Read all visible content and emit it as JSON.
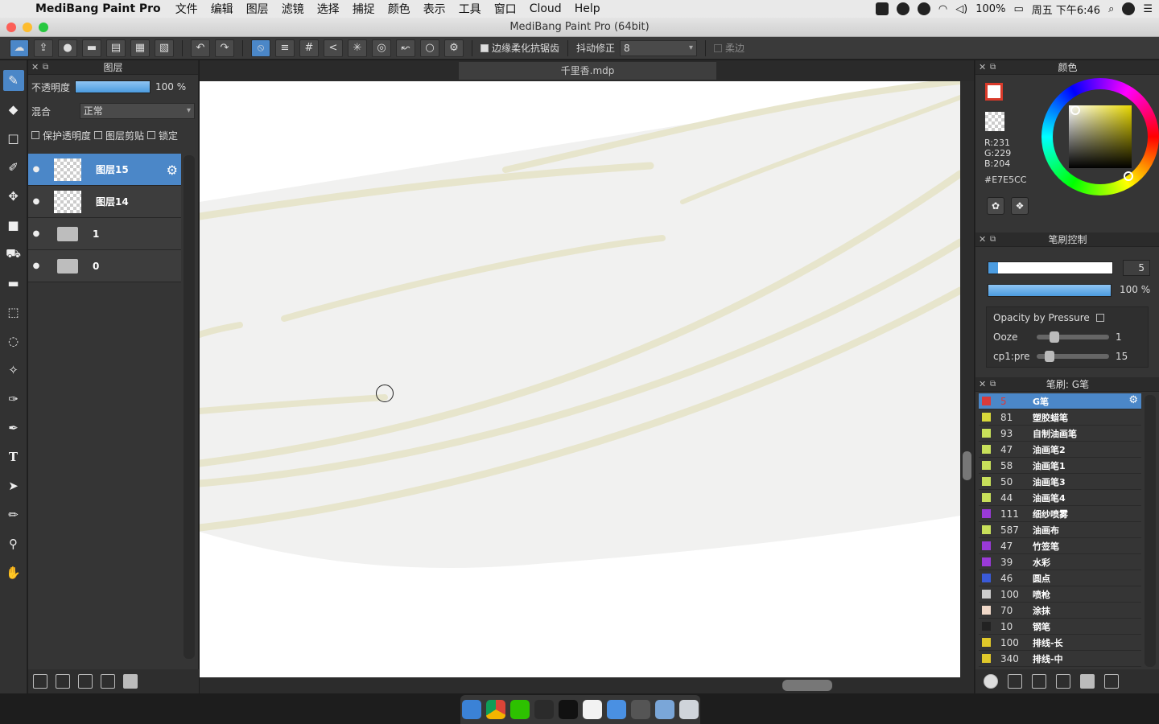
{
  "menubar": {
    "app_name": "MediBang Paint Pro",
    "items": [
      "文件",
      "编辑",
      "图层",
      "滤镜",
      "选择",
      "捕捉",
      "颜色",
      "表示",
      "工具",
      "窗口",
      "Cloud",
      "Help"
    ],
    "battery": "100%",
    "datetime": "周五 下午6:46"
  },
  "window": {
    "title": "MediBang Paint Pro (64bit)"
  },
  "toolbar": {
    "antialias_label": "边缘柔化抗锯齿",
    "stabilizer_label": "抖动修正",
    "stabilizer_value": "8",
    "soft_label": "柔边"
  },
  "layer_panel": {
    "title": "图层",
    "opacity_label": "不透明度",
    "opacity_value": "100 %",
    "opacity_fraction": 1.0,
    "blend_label": "混合",
    "blend_value": "正常",
    "protect_alpha_label": "保护透明度",
    "clip_label": "图层剪贴",
    "lock_label": "锁定",
    "layers": [
      {
        "name": "图层15",
        "type": "layer",
        "selected": true
      },
      {
        "name": "图层14",
        "type": "layer",
        "selected": false
      },
      {
        "name": "1",
        "type": "folder",
        "selected": false
      },
      {
        "name": "0",
        "type": "folder",
        "selected": false
      }
    ]
  },
  "document": {
    "tab_name": "千里香.mdp"
  },
  "color_panel": {
    "title": "颜色",
    "r": "R:231",
    "g": "G:229",
    "b": "B:204",
    "hex": "#E7E5CC",
    "hue_color": "#e8d800"
  },
  "brush_control": {
    "title": "笔刷控制",
    "size_value": "5",
    "opacity_value": "100 %",
    "opacity_by_pressure_label": "Opacity by Pressure",
    "ooze_label": "Ooze",
    "ooze_value": "1",
    "cp1_label": "cp1:pre",
    "cp1_value": "15"
  },
  "brush_list": {
    "title": "笔刷: G笔",
    "items": [
      {
        "size": "5",
        "name": "G笔",
        "color": "#d93a3a",
        "selected": true
      },
      {
        "size": "81",
        "name": "塑胶蜡笔",
        "color": "#d8d83a",
        "selected": false
      },
      {
        "size": "93",
        "name": "自制油画笔",
        "color": "#c8e05a",
        "selected": false
      },
      {
        "size": "47",
        "name": "油画笔2",
        "color": "#c8e05a",
        "selected": false
      },
      {
        "size": "58",
        "name": "油画笔1",
        "color": "#c8e05a",
        "selected": false
      },
      {
        "size": "50",
        "name": "油画笔3",
        "color": "#c8e05a",
        "selected": false
      },
      {
        "size": "44",
        "name": "油画笔4",
        "color": "#c8e05a",
        "selected": false
      },
      {
        "size": "111",
        "name": "细纱喷雾",
        "color": "#9a3ad8",
        "selected": false
      },
      {
        "size": "587",
        "name": "油画布",
        "color": "#c8e05a",
        "selected": false
      },
      {
        "size": "47",
        "name": "竹签笔",
        "color": "#9a3ad8",
        "selected": false
      },
      {
        "size": "39",
        "name": "水彩",
        "color": "#9a3ad8",
        "selected": false
      },
      {
        "size": "46",
        "name": "圆点",
        "color": "#3a5ad8",
        "selected": false
      },
      {
        "size": "100",
        "name": "喷枪",
        "color": "#cccccc",
        "selected": false
      },
      {
        "size": "70",
        "name": "涂抹",
        "color": "#f0d8c8",
        "selected": false
      },
      {
        "size": "10",
        "name": "钢笔",
        "color": "#222222",
        "selected": false
      },
      {
        "size": "100",
        "name": "排线-长",
        "color": "#e0c82a",
        "selected": false
      },
      {
        "size": "340",
        "name": "排线-中",
        "color": "#e0c82a",
        "selected": false
      }
    ]
  }
}
